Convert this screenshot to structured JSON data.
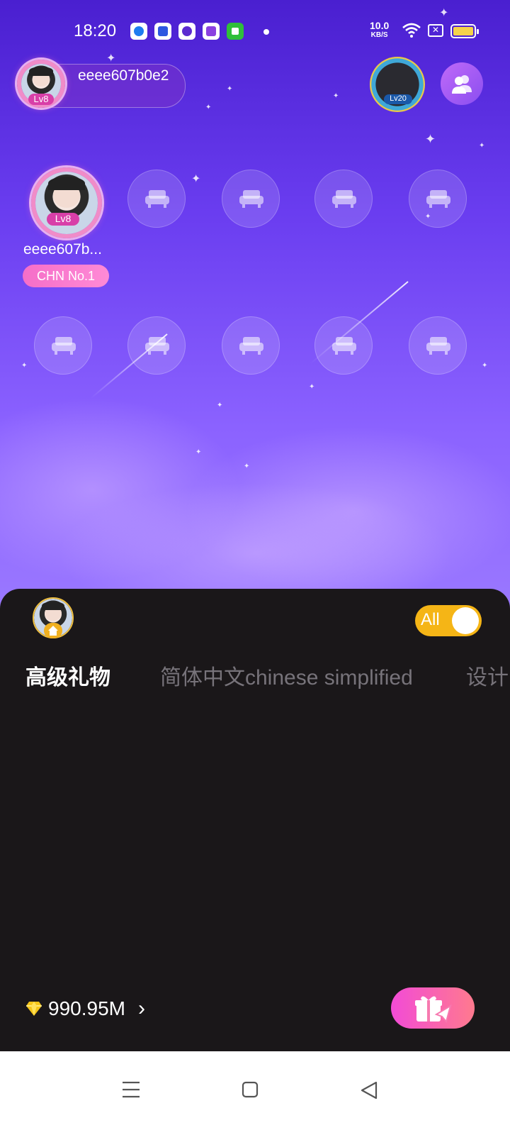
{
  "status_bar": {
    "time": "18:20",
    "net_speed_value": "10.0",
    "net_speed_unit": "KB/S",
    "app_icons": [
      "browser-icon",
      "baidu-icon",
      "app-icon",
      "app-icon",
      "shop-icon"
    ],
    "battery_icon": "battery-icon",
    "wifi_icon": "wifi-icon"
  },
  "room": {
    "host_name": "eeee607b0e2",
    "host_level": "Lv8",
    "top_right_level": "Lv20",
    "users_button_icon": "users-icon",
    "seats": [
      {
        "occupied": true,
        "name": "eeee607b...",
        "level": "Lv8",
        "tag": "CHN No.1"
      },
      {
        "occupied": false,
        "icon": "sofa-icon"
      },
      {
        "occupied": false,
        "icon": "sofa-icon"
      },
      {
        "occupied": false,
        "icon": "sofa-icon"
      },
      {
        "occupied": false,
        "icon": "sofa-icon"
      },
      {
        "occupied": false,
        "icon": "sofa-icon"
      },
      {
        "occupied": false,
        "icon": "sofa-icon"
      },
      {
        "occupied": false,
        "icon": "sofa-icon"
      },
      {
        "occupied": false,
        "icon": "sofa-icon"
      },
      {
        "occupied": false,
        "icon": "sofa-icon"
      }
    ]
  },
  "gift_panel": {
    "toggle_label": "All",
    "toggle_on": true,
    "tabs": [
      {
        "label": "高级礼物",
        "active": true
      },
      {
        "label": "简体中文chinese simplified",
        "active": false
      },
      {
        "label": "设计",
        "active": false
      }
    ],
    "balance": "990.95M",
    "balance_icon": "diamond-icon",
    "send_icon": "gift-send-icon"
  },
  "nav_bar": {
    "icons": [
      "menu-icon",
      "home-icon",
      "back-icon"
    ]
  },
  "colors": {
    "room_gradient_top": "#4a1fd0",
    "room_gradient_bottom": "#9a78ff",
    "panel_bg": "#1a1719",
    "toggle": "#f5b516",
    "tag_pink": "#f56ec8",
    "gift_button_start": "#f24bd6",
    "gift_button_end": "#ff7a8e"
  }
}
